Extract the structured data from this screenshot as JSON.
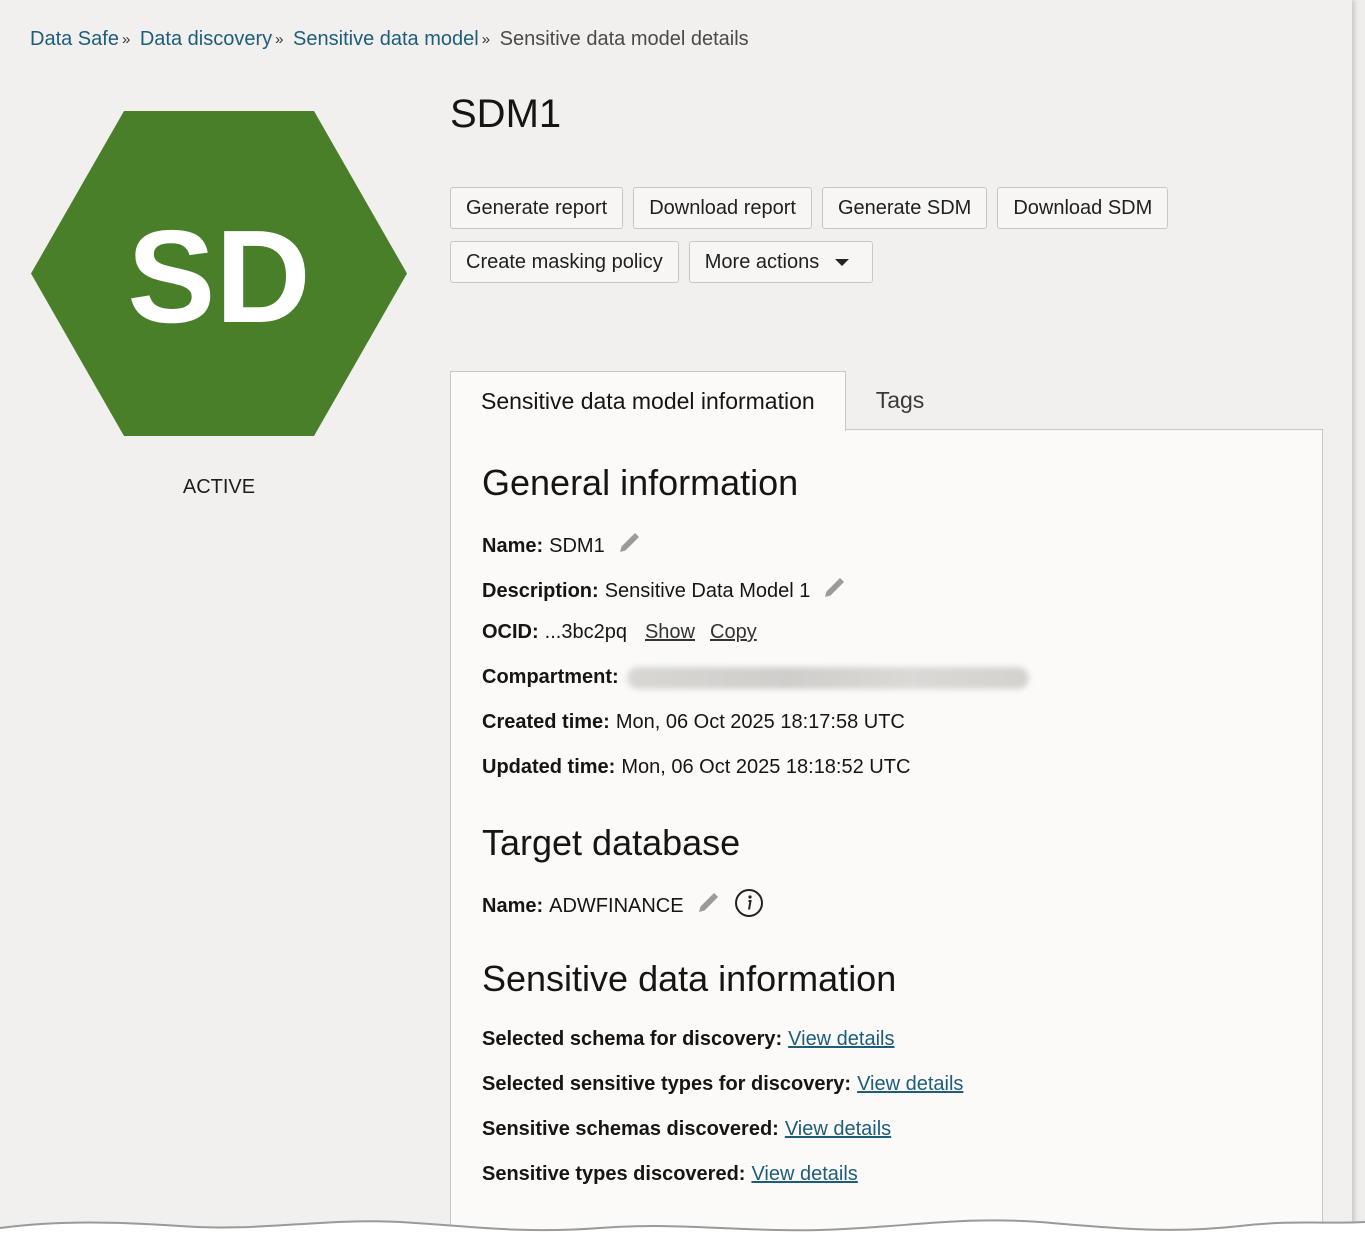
{
  "breadcrumb": {
    "items": [
      "Data Safe",
      "Data discovery",
      "Sensitive data model"
    ],
    "current": "Sensitive data model details",
    "separator": "»"
  },
  "resource": {
    "icon_text": "SD",
    "icon_color": "#4a7f2a",
    "status": "ACTIVE",
    "title": "SDM1"
  },
  "actions": {
    "generate_report": "Generate report",
    "download_report": "Download report",
    "generate_sdm": "Generate SDM",
    "download_sdm": "Download SDM",
    "create_masking_policy": "Create masking policy",
    "more_actions": "More actions"
  },
  "tabs": [
    {
      "label": "Sensitive data model information",
      "active": true
    },
    {
      "label": "Tags",
      "active": false
    }
  ],
  "general": {
    "heading": "General information",
    "name_label": "Name:",
    "name_value": "SDM1",
    "description_label": "Description:",
    "description_value": "Sensitive Data Model 1",
    "ocid_label": "OCID:",
    "ocid_value": "...3bc2pq",
    "ocid_show": "Show",
    "ocid_copy": "Copy",
    "compartment_label": "Compartment:",
    "created_label": "Created time:",
    "created_value": "Mon, 06 Oct 2025 18:17:58 UTC",
    "updated_label": "Updated time:",
    "updated_value": "Mon, 06 Oct 2025 18:18:52 UTC"
  },
  "target": {
    "heading": "Target database",
    "name_label": "Name:",
    "name_value": "ADWFINANCE"
  },
  "sensitive": {
    "heading": "Sensitive data information",
    "schema_label": "Selected schema for discovery:",
    "types_label": "Selected sensitive types for discovery:",
    "schemas_discovered_label": "Sensitive schemas discovered:",
    "types_discovered_label": "Sensitive types discovered:",
    "view_details": "View details"
  },
  "icons": [
    "pencil-icon",
    "info-icon",
    "dropdown-caret-icon"
  ],
  "colors": {
    "link": "#1d5d7a",
    "accent_green": "#4a7f2a"
  }
}
